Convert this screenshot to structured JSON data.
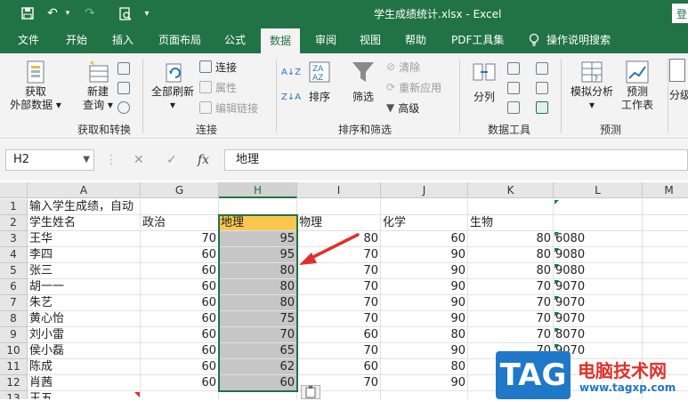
{
  "titlebar": {
    "title": "学生成绩统计.xlsx  -  Excel",
    "login": "登"
  },
  "tabs": [
    "文件",
    "开始",
    "插入",
    "页面布局",
    "公式",
    "数据",
    "审阅",
    "视图",
    "帮助",
    "PDF工具集",
    "操作说明搜索"
  ],
  "active_tab": "数据",
  "ribbon": {
    "get_data": {
      "line1": "获取",
      "line2": "外部数据"
    },
    "new_query": {
      "line1": "新建",
      "line2": "查询"
    },
    "group_get": "获取和转换",
    "refresh_all": "全部刷新",
    "connections": "连接",
    "properties": "属性",
    "edit_links": "编辑链接",
    "group_conn": "连接",
    "sort": "排序",
    "filter": "筛选",
    "clear": "清除",
    "reapply": "重新应用",
    "advanced": "高级",
    "group_sort": "排序和筛选",
    "text_to_columns": "分列",
    "group_tools": "数据工具",
    "what_if": "模拟分析",
    "forecast_sheet": {
      "line1": "预测",
      "line2": "工作表"
    },
    "group_forecast": "预测",
    "outline": "分级"
  },
  "formula": {
    "name_box": "H2",
    "cancel": "✕",
    "enter": "✓",
    "fx": "fx",
    "value": "地理"
  },
  "sheet": {
    "columns": [
      "A",
      "G",
      "H",
      "I",
      "J",
      "K",
      "L",
      "M"
    ],
    "selected_column": "H",
    "rows": [
      {
        "n": "1",
        "A": "输入学生成绩，自动",
        "G": "",
        "H": "",
        "I": "",
        "J": "",
        "K": "",
        "L": ""
      },
      {
        "n": "2",
        "A": "学生姓名",
        "G": "政治",
        "H": "地理",
        "I": "物理",
        "J": "化学",
        "K": "生物",
        "L": ""
      },
      {
        "n": "3",
        "A": "王华",
        "G": "70",
        "H": "95",
        "I": "80",
        "J": "60",
        "K": "80",
        "L": "6080"
      },
      {
        "n": "4",
        "A": "李四",
        "G": "60",
        "H": "95",
        "I": "70",
        "J": "90",
        "K": "80",
        "L": "9080"
      },
      {
        "n": "5",
        "A": "张三",
        "G": "60",
        "H": "80",
        "I": "70",
        "J": "90",
        "K": "80",
        "L": "9080"
      },
      {
        "n": "6",
        "A": "胡一一",
        "G": "60",
        "H": "80",
        "I": "70",
        "J": "90",
        "K": "70",
        "L": "9070"
      },
      {
        "n": "7",
        "A": "朱艺",
        "G": "60",
        "H": "80",
        "I": "70",
        "J": "90",
        "K": "70",
        "L": "9070"
      },
      {
        "n": "8",
        "A": "黄心怡",
        "G": "60",
        "H": "75",
        "I": "70",
        "J": "90",
        "K": "70",
        "L": "9070"
      },
      {
        "n": "9",
        "A": "刘小雷",
        "G": "60",
        "H": "70",
        "I": "60",
        "J": "80",
        "K": "70",
        "L": "8070"
      },
      {
        "n": "10",
        "A": "侯小磊",
        "G": "60",
        "H": "65",
        "I": "70",
        "J": "90",
        "K": "70",
        "L": "9070"
      },
      {
        "n": "11",
        "A": "陈成",
        "G": "60",
        "H": "62",
        "I": "60",
        "J": "80",
        "K": "",
        "L": ""
      },
      {
        "n": "12",
        "A": "肖茜",
        "G": "60",
        "H": "60",
        "I": "70",
        "J": "90",
        "K": "",
        "L": ""
      },
      {
        "n": "13",
        "A": "王五",
        "G": "",
        "H": "",
        "I": "",
        "J": "",
        "K": "",
        "L": ""
      }
    ]
  },
  "watermark": {
    "tag": "TAG",
    "cn": "电脑技术网",
    "url": "www.tagxp.com"
  },
  "colors": {
    "accent": "#217346",
    "selected_header": "#f9c74f",
    "arrow": "#e0302b"
  }
}
